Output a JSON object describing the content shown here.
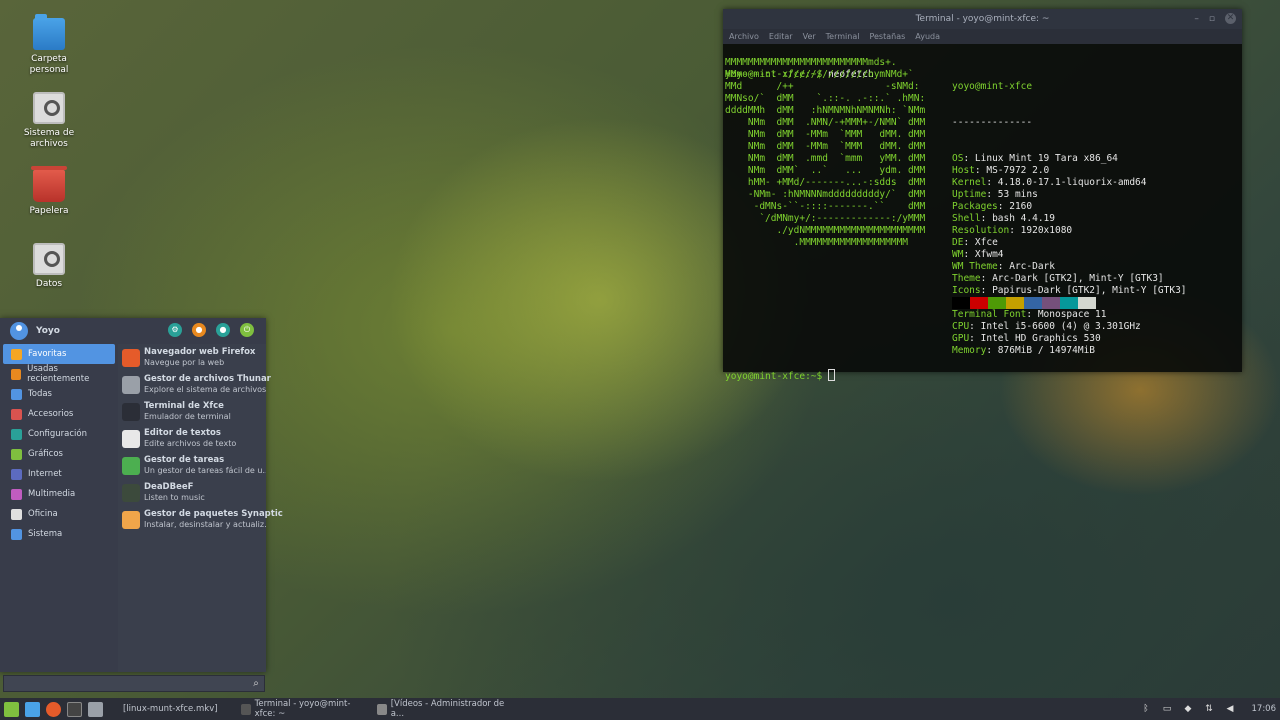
{
  "desktop": {
    "icons": [
      {
        "label": "Carpeta\npersonal",
        "icon": "home-folder-icon"
      },
      {
        "label": "Sistema de\narchivos",
        "icon": "drive-icon"
      },
      {
        "label": "Papelera",
        "icon": "trash-icon"
      },
      {
        "label": "Datos",
        "icon": "drive-icon"
      }
    ]
  },
  "terminal": {
    "title": "Terminal - yoyo@mint-xfce: ~",
    "menu": [
      "Archivo",
      "Editar",
      "Ver",
      "Terminal",
      "Pestañas",
      "Ayuda"
    ],
    "prompt": "yoyo@mint-xfce:~$",
    "command": " neofetch",
    "logo": "MMMMMMMMMMMMMMMMMMMMMMMMMmds+.\nMMm----::-://////////////oymNMd+`\nMMd      /++                -sNMd:\nMMNso/`  dMM    `.::-. .-::.` .hMN:\nddddMMh  dMM   :hNMNMNhNMNMNh: `NMm\n    NMm  dMM  .NMN/-+MMM+-/NMN` dMM\n    NMm  dMM  -MMm  `MMM   dMM. dMM\n    NMm  dMM  -MMm  `MMM   dMM. dMM\n    NMm  dMM  .mmd  `mmm   yMM. dMM\n    NMm  dMM`  ..`   ...   ydm. dMM\n    hMM- +MMd/-------...-:sdds  dMM\n    -NMm- :hNMNNNmdddddddddy/`  dMM\n     -dMNs-``-::::-------.``    dMM\n      `/dMNmy+/:-------------:/yMMM\n         ./ydNMMMMMMMMMMMMMMMMMMMMM\n            .MMMMMMMMMMMMMMMMMMM",
    "header": "yoyo@mint-xfce",
    "separator": "--------------",
    "info": [
      {
        "key": "OS",
        "value": "Linux Mint 19 Tara x86_64"
      },
      {
        "key": "Host",
        "value": "MS-7972 2.0"
      },
      {
        "key": "Kernel",
        "value": "4.18.0-17.1-liquorix-amd64"
      },
      {
        "key": "Uptime",
        "value": "53 mins"
      },
      {
        "key": "Packages",
        "value": "2160"
      },
      {
        "key": "Shell",
        "value": "bash 4.4.19"
      },
      {
        "key": "Resolution",
        "value": "1920x1080"
      },
      {
        "key": "DE",
        "value": "Xfce"
      },
      {
        "key": "WM",
        "value": "Xfwm4"
      },
      {
        "key": "WM Theme",
        "value": "Arc-Dark"
      },
      {
        "key": "Theme",
        "value": "Arc-Dark [GTK2], Mint-Y [GTK3]"
      },
      {
        "key": "Icons",
        "value": "Papirus-Dark [GTK2], Mint-Y [GTK3]"
      },
      {
        "key": "Terminal",
        "value": "xfce4-terminal"
      },
      {
        "key": "Terminal Font",
        "value": "Monospace 11"
      },
      {
        "key": "CPU",
        "value": "Intel i5-6600 (4) @ 3.301GHz"
      },
      {
        "key": "GPU",
        "value": "Intel HD Graphics 530"
      },
      {
        "key": "Memory",
        "value": "876MiB / 14974MiB"
      }
    ],
    "palette": [
      "#000000",
      "#cc0000",
      "#4e9a06",
      "#c4a000",
      "#3465a4",
      "#75507b",
      "#06989a",
      "#d3d7cf"
    ]
  },
  "menu": {
    "user": "Yoyo",
    "categories": [
      "Favoritas",
      "Usadas recientemente",
      "Todas",
      "Accesorios",
      "Configuración",
      "Gráficos",
      "Internet",
      "Multimedia",
      "Oficina",
      "Sistema"
    ],
    "category_colors": [
      "#f5a623",
      "#e8891f",
      "#5294e2",
      "#d9534f",
      "#2aa198",
      "#7fbf3f",
      "#5c6bc0",
      "#c05cc0",
      "#e0e0e0",
      "#5294e2"
    ],
    "apps": [
      {
        "title": "Navegador web Firefox",
        "desc": "Navegue por la web",
        "color": "#e55b2a"
      },
      {
        "title": "Gestor de archivos Thunar",
        "desc": "Explore el sistema de archivos...",
        "color": "#9aa0a8"
      },
      {
        "title": "Terminal de Xfce",
        "desc": "Emulador de terminal",
        "color": "#2b2e37"
      },
      {
        "title": "Editor de textos",
        "desc": "Edite archivos de texto",
        "color": "#e8e8e8"
      },
      {
        "title": "Gestor de tareas",
        "desc": "Un gestor de tareas fácil de u...",
        "color": "#4caf50"
      },
      {
        "title": "DeaDBeeF",
        "desc": "Listen to music",
        "color": "#3c4a3c"
      },
      {
        "title": "Gestor de paquetes Synaptic",
        "desc": "Instalar, desinstalar y actualiz...",
        "color": "#f0a54a"
      }
    ],
    "search_placeholder": ""
  },
  "taskbar": {
    "tasks": [
      {
        "label": "[linux-munt-xfce.mkv]"
      },
      {
        "label": "Terminal - yoyo@mint-xfce: ~"
      },
      {
        "label": "[Vídeos - Administrador de a..."
      }
    ],
    "clock": "17:06"
  }
}
